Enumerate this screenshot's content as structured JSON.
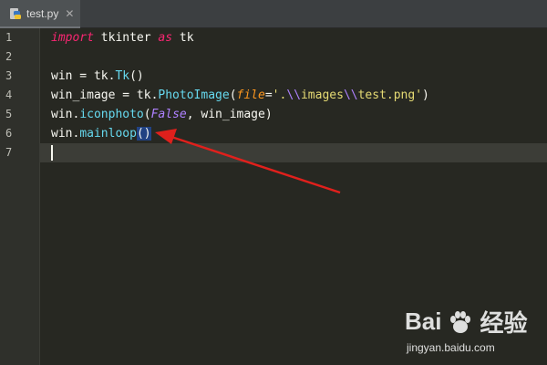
{
  "tab": {
    "filename": "test.py",
    "close_glyph": "✕",
    "icon": "python-file-icon"
  },
  "editor": {
    "line_numbers": [
      "1",
      "2",
      "3",
      "4",
      "5",
      "6",
      "7"
    ],
    "lines": [
      {
        "tokens": [
          {
            "t": "import",
            "c": "kw"
          },
          {
            "t": " tkinter ",
            "c": ""
          },
          {
            "t": "as",
            "c": "kw"
          },
          {
            "t": " tk",
            "c": ""
          }
        ]
      },
      {
        "tokens": []
      },
      {
        "tokens": [
          {
            "t": "win = tk.",
            "c": ""
          },
          {
            "t": "Tk",
            "c": "fn"
          },
          {
            "t": "()",
            "c": ""
          }
        ]
      },
      {
        "tokens": [
          {
            "t": "win_image = tk.",
            "c": ""
          },
          {
            "t": "PhotoImage",
            "c": "fn"
          },
          {
            "t": "(",
            "c": ""
          },
          {
            "t": "file",
            "c": "param"
          },
          {
            "t": "=",
            "c": ""
          },
          {
            "t": "'.",
            "c": "str"
          },
          {
            "t": "\\\\",
            "c": "esc"
          },
          {
            "t": "images",
            "c": "str"
          },
          {
            "t": "\\\\",
            "c": "esc"
          },
          {
            "t": "test.png'",
            "c": "str"
          },
          {
            "t": ")",
            "c": ""
          }
        ]
      },
      {
        "tokens": [
          {
            "t": "win.",
            "c": ""
          },
          {
            "t": "iconphoto",
            "c": "fn"
          },
          {
            "t": "(",
            "c": ""
          },
          {
            "t": "False",
            "c": "const"
          },
          {
            "t": ", win_image)",
            "c": ""
          }
        ]
      },
      {
        "tokens": [
          {
            "t": "win.",
            "c": ""
          },
          {
            "t": "mainloop",
            "c": "fn"
          },
          {
            "t": "()",
            "c": "sel"
          }
        ]
      },
      {
        "tokens": []
      }
    ],
    "current_line": 7
  },
  "annotation": {
    "type": "red-arrow",
    "color": "#e0201c",
    "points_to": "mainloop-parentheses"
  },
  "watermark": {
    "logo_text": "Bai",
    "logo_suffix": "经验",
    "url": "jingyan.baidu.com"
  },
  "colors": {
    "background": "#272822",
    "keyword": "#f92672",
    "function": "#66d9ef",
    "string": "#e6db74",
    "selection": "#214283"
  }
}
